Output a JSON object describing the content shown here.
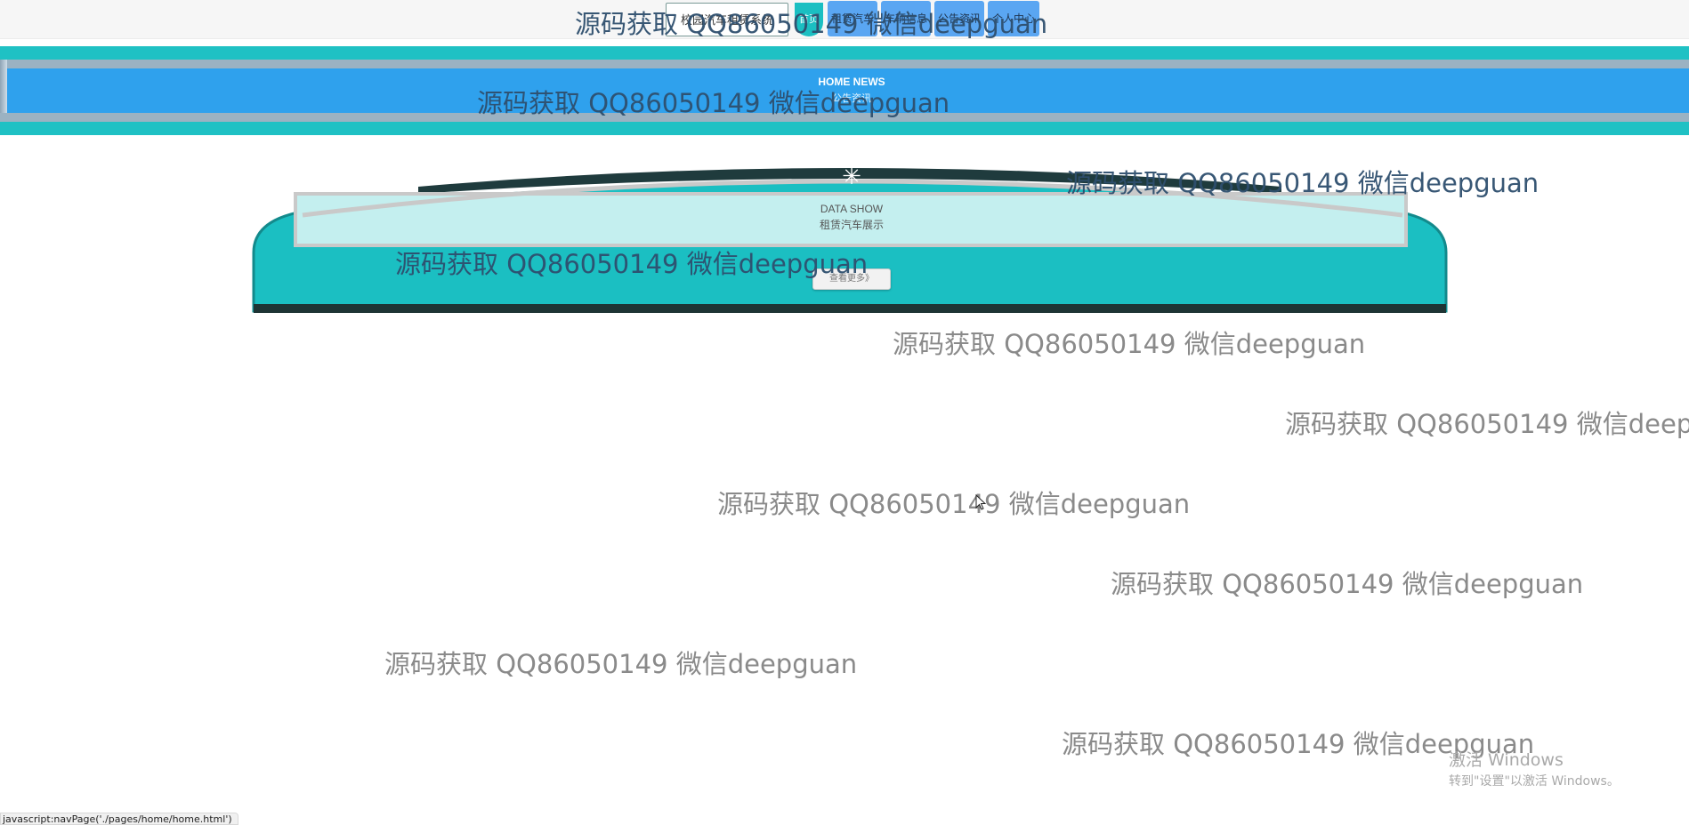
{
  "header": {
    "brand": "校园汽车租赁系统",
    "nav": [
      {
        "label": "首页"
      },
      {
        "label": "租赁汽车"
      },
      {
        "label": "车辆信息"
      },
      {
        "label": "公告资讯"
      },
      {
        "label": "个人中心"
      }
    ]
  },
  "banner": {
    "title": "HOME NEWS",
    "subtitle": "公告资讯"
  },
  "data_show": {
    "title": "DATA SHOW",
    "subtitle": "租赁汽车展示",
    "more_button": "查看更多》"
  },
  "watermark": {
    "text": "源码获取 QQ86050149 微信deepguan"
  },
  "os_notice": {
    "title": "激活 Windows",
    "subtitle": "转到\"设置\"以激活 Windows。"
  },
  "status_bar": {
    "text": "javascript:navPage('./pages/home/home.html')"
  },
  "colors": {
    "teal": "#1fc1c4",
    "banner_blue": "#2fa1ed",
    "nav_blue": "#5aa6f2",
    "panel_light": "#c4efef"
  },
  "icons": {
    "home_badge": "circle-badge",
    "panel_ornament": "gear-icon",
    "pointer": "mouse-cursor-icon"
  }
}
